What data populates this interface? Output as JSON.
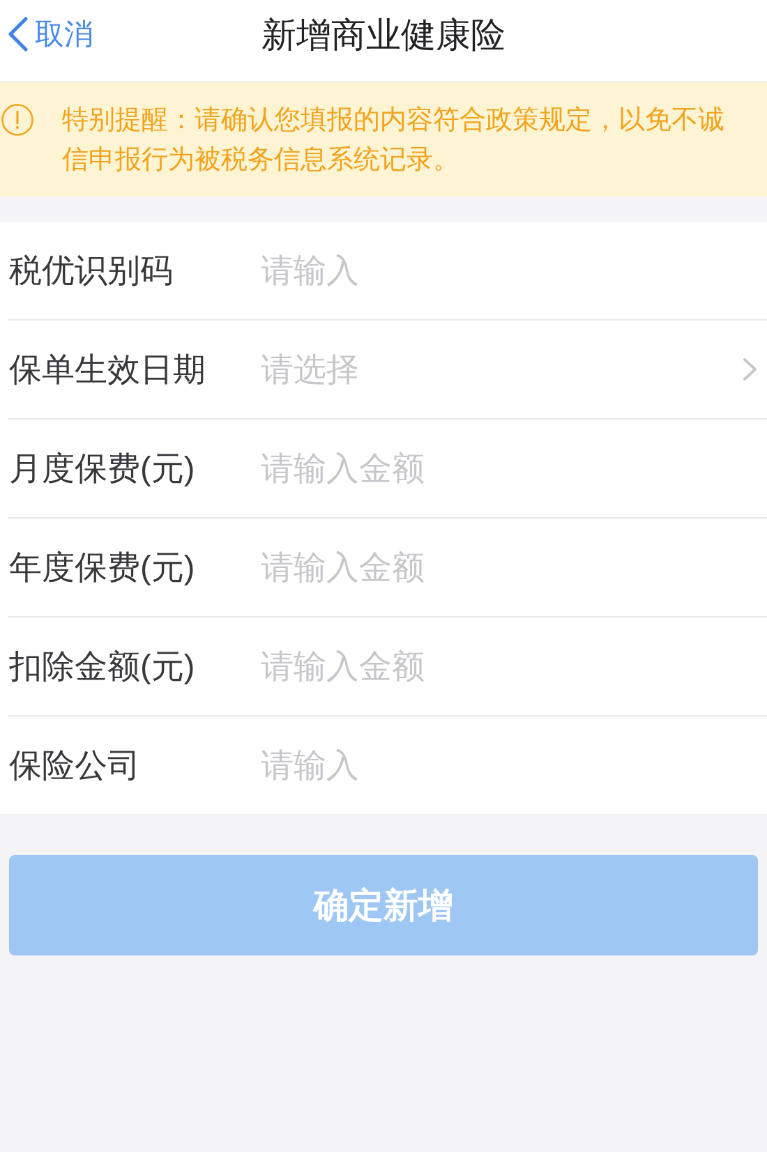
{
  "header": {
    "back_button": {
      "label": "取消"
    },
    "title": "新增商业健康险"
  },
  "notice": {
    "text": "特别提醒：请确认您填报的内容符合政策规定，以免不诚信申报行为被税务信息系统记录。"
  },
  "form": {
    "fields": [
      {
        "kind": "input",
        "label": "税优识别码",
        "placeholder": "请输入"
      },
      {
        "kind": "select",
        "label": "保单生效日期",
        "placeholder": "请选择"
      },
      {
        "kind": "input",
        "label": "月度保费(元)",
        "placeholder": "请输入金额"
      },
      {
        "kind": "input",
        "label": "年度保费(元)",
        "placeholder": "请输入金额"
      },
      {
        "kind": "input",
        "label": "扣除金额(元)",
        "placeholder": "请输入金额"
      },
      {
        "kind": "input",
        "label": "保险公司",
        "placeholder": "请输入"
      }
    ]
  },
  "submit_button": {
    "label": "确定新增",
    "disabled": true
  }
}
